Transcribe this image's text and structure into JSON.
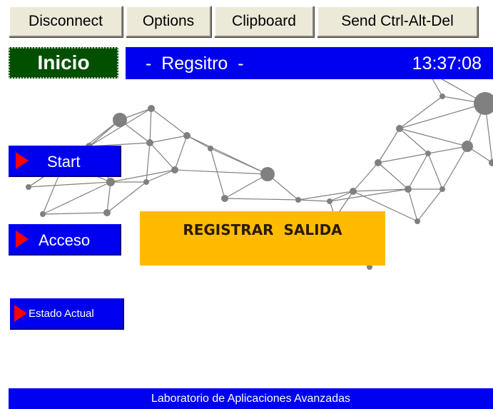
{
  "toolbar": {
    "disconnect": "Disconnect",
    "options": "Options",
    "clipboard": "Clipboard",
    "send_cad": "Send Ctrl-Alt-Del"
  },
  "header": {
    "inicio": "Inicio",
    "title": "-  Regsitro  -",
    "time": "13:37:08"
  },
  "menu": {
    "start": "Start",
    "acceso": "Acceso",
    "estado": "Estado Actual"
  },
  "main": {
    "registrar": "REGISTRAR  SALIDA"
  },
  "footer": {
    "text": "Laboratorio de Aplicaciones  Avanzadas"
  },
  "colors": {
    "header_blue": "#0000f0",
    "inicio_green": "#005000",
    "registrar_orange": "#ffbb00",
    "arrow_red": "#ff0000",
    "network_gray": "#808080"
  },
  "icons": {
    "menu_arrow": "red-triangle-icon",
    "background": "network-graph"
  }
}
